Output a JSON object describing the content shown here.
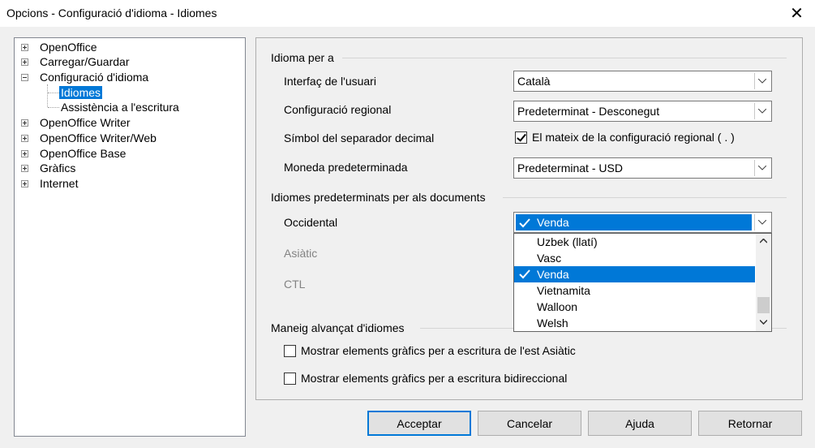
{
  "window": {
    "title": "Opcions - Configuració d'idioma - Idiomes",
    "close": "✕"
  },
  "tree": {
    "items": [
      {
        "label": "OpenOffice",
        "expander": "plus"
      },
      {
        "label": "Carregar/Guardar",
        "expander": "plus"
      },
      {
        "label": "Configuració d'idioma",
        "expander": "minus"
      },
      {
        "label": "Idiomes",
        "selected": true
      },
      {
        "label": "Assistència a l'escritura"
      },
      {
        "label": "OpenOffice Writer",
        "expander": "plus"
      },
      {
        "label": "OpenOffice Writer/Web",
        "expander": "plus"
      },
      {
        "label": "OpenOffice Base",
        "expander": "plus"
      },
      {
        "label": "Gràfics",
        "expander": "plus"
      },
      {
        "label": "Internet",
        "expander": "plus"
      }
    ]
  },
  "language_for": {
    "section": "Idioma per a",
    "ui_label": "Interfaç de l'usuari",
    "ui_value": "Català",
    "locale_label": "Configuració regional",
    "locale_value": "Predeterminat - Desconegut",
    "decimal_label": "Símbol del separador decimal",
    "decimal_check": "El mateix de la configuració regional ( . )",
    "currency_label": "Moneda predeterminada",
    "currency_value": "Predeterminat - USD"
  },
  "default_langs": {
    "section": "Idiomes predeterminats per als documents",
    "western_label": "Occidental",
    "western_value": "Venda",
    "asian_label": "Asiàtic",
    "ctl_label": "CTL"
  },
  "dropdown": {
    "items": [
      "Uzbek (llatí)",
      "Vasc",
      "Venda",
      "Vietnamita",
      "Walloon",
      "Welsh"
    ],
    "highlighted": "Venda"
  },
  "advanced": {
    "section": "Maneig alvançat d'idiomes",
    "asian_check": "Mostrar elements gràfics per a escritura de l'est Asiàtic",
    "bidi_check": "Mostrar elements gràfics per a escritura bidireccional"
  },
  "buttons": {
    "ok": "Acceptar",
    "cancel": "Cancelar",
    "help": "Ajuda",
    "reset": "Retornar"
  },
  "colors": {
    "accent": "#0078d7"
  }
}
